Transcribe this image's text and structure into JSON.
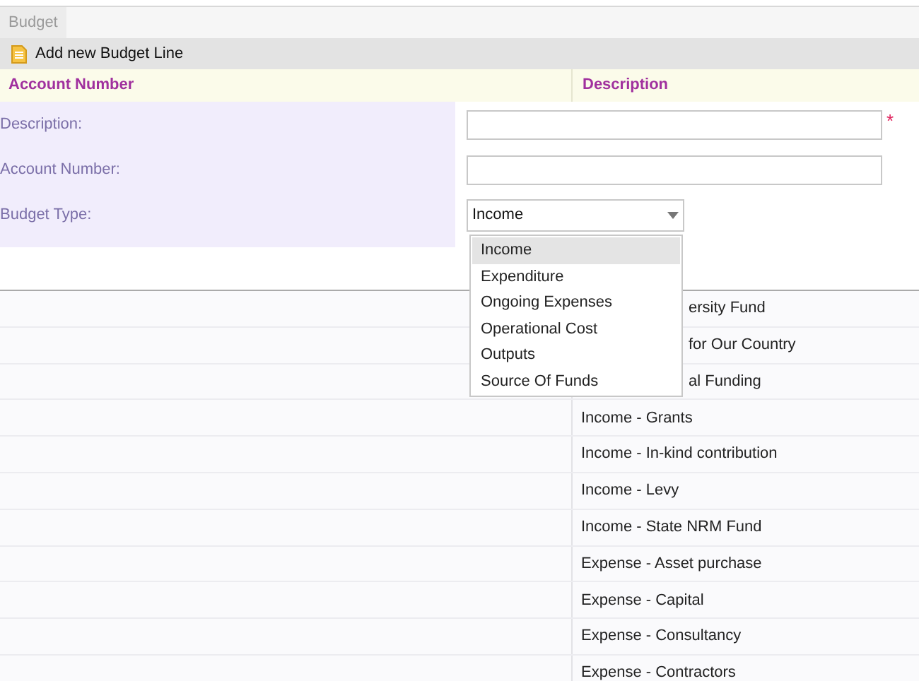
{
  "tabs": [
    {
      "label": "Budget",
      "selected": true
    }
  ],
  "toolbar": {
    "add_button": "Add new Budget Line"
  },
  "table": {
    "columns": [
      "Account Number",
      "Description"
    ],
    "rows": [
      {
        "description": "ersity Fund"
      },
      {
        "description": "for Our Country"
      },
      {
        "description": "al Funding"
      },
      {
        "description": "Income - Grants"
      },
      {
        "description": "Income - In-kind contribution"
      },
      {
        "description": "Income - Levy"
      },
      {
        "description": "Income - State NRM Fund"
      },
      {
        "description": "Expense - Asset purchase"
      },
      {
        "description": "Expense - Capital"
      },
      {
        "description": "Expense - Consultancy"
      },
      {
        "description": "Expense - Contractors"
      }
    ]
  },
  "form": {
    "fields": [
      {
        "kind": "text",
        "label": "Description:",
        "required": true
      },
      {
        "kind": "text",
        "label": "Account Number:",
        "required": false
      },
      {
        "kind": "select",
        "label": "Budget Type:",
        "value": "Income",
        "required": false
      }
    ],
    "required_mark": "*",
    "dropdown": {
      "options": [
        {
          "label": "Income",
          "selected": true
        },
        {
          "label": "Expenditure",
          "selected": false
        },
        {
          "label": "Ongoing Expenses",
          "selected": false
        },
        {
          "label": "Operational Cost",
          "selected": false
        },
        {
          "label": "Outputs",
          "selected": false
        },
        {
          "label": "Source Of Funds",
          "selected": false
        }
      ]
    }
  }
}
